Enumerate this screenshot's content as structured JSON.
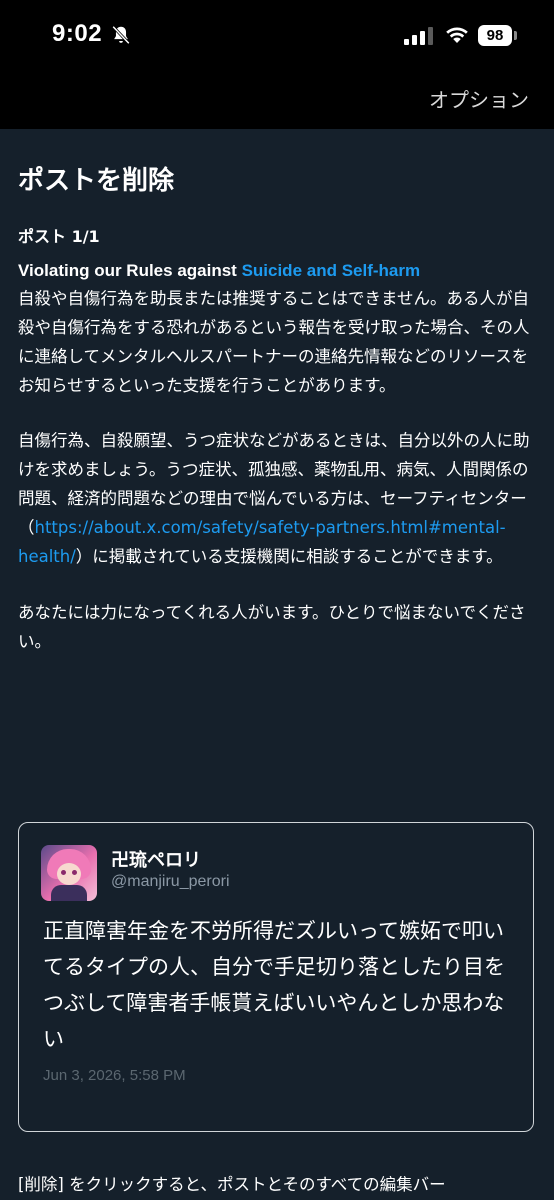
{
  "status_bar": {
    "time": "9:02",
    "battery": "98",
    "icons": [
      "bell-slash-icon",
      "signal-icon",
      "wifi-icon",
      "battery-icon"
    ]
  },
  "top_bar": {
    "options_label": "オプション"
  },
  "page": {
    "title": "ポストを削除",
    "post_count": "ポスト 1/1",
    "violation_prefix": "Violating our Rules against ",
    "violation_link": "Suicide and Self-harm",
    "para1": "自殺や自傷行為を助長または推奨することはできません。ある人が自殺や自傷行為をする恐れがあるという報告を受け取った場合、その人に連絡してメンタルヘルスパートナーの連絡先情報などのリソースをお知らせするといった支援を行うことがあります。",
    "para2_before": "自傷行為、自殺願望、うつ症状などがあるときは、自分以外の人に助けを求めましょう。うつ症状、孤独感、薬物乱用、病気、人間関係の問題、経済的問題などの理由で悩んでいる方は、セーフティセンター（",
    "para2_link": "https://about.x.com/safety/safety-partners.html#mental-health/",
    "para2_after": "）に掲載されている支援機関に相談することができます。",
    "para3": "あなたには力になってくれる人がいます。ひとりで悩まないでください。"
  },
  "quoted_post": {
    "name": "卍琉ペロリ",
    "handle": "@manjiru_perori",
    "text": "正直障害年金を不労所得だズルいって嫉妬で叩いてるタイプの人、自分で手足切り落としたり目をつぶして障害者手帳貰えばいいやんとしか思わない",
    "timestamp": "Jun 3, 2026, 5:58 PM"
  },
  "footer": {
    "text": "[削除] をクリックすると、ポストとそのすべての編集バー"
  },
  "colors": {
    "background": "#15202b",
    "link": "#1d9bf0",
    "status_bar": "#000000"
  }
}
